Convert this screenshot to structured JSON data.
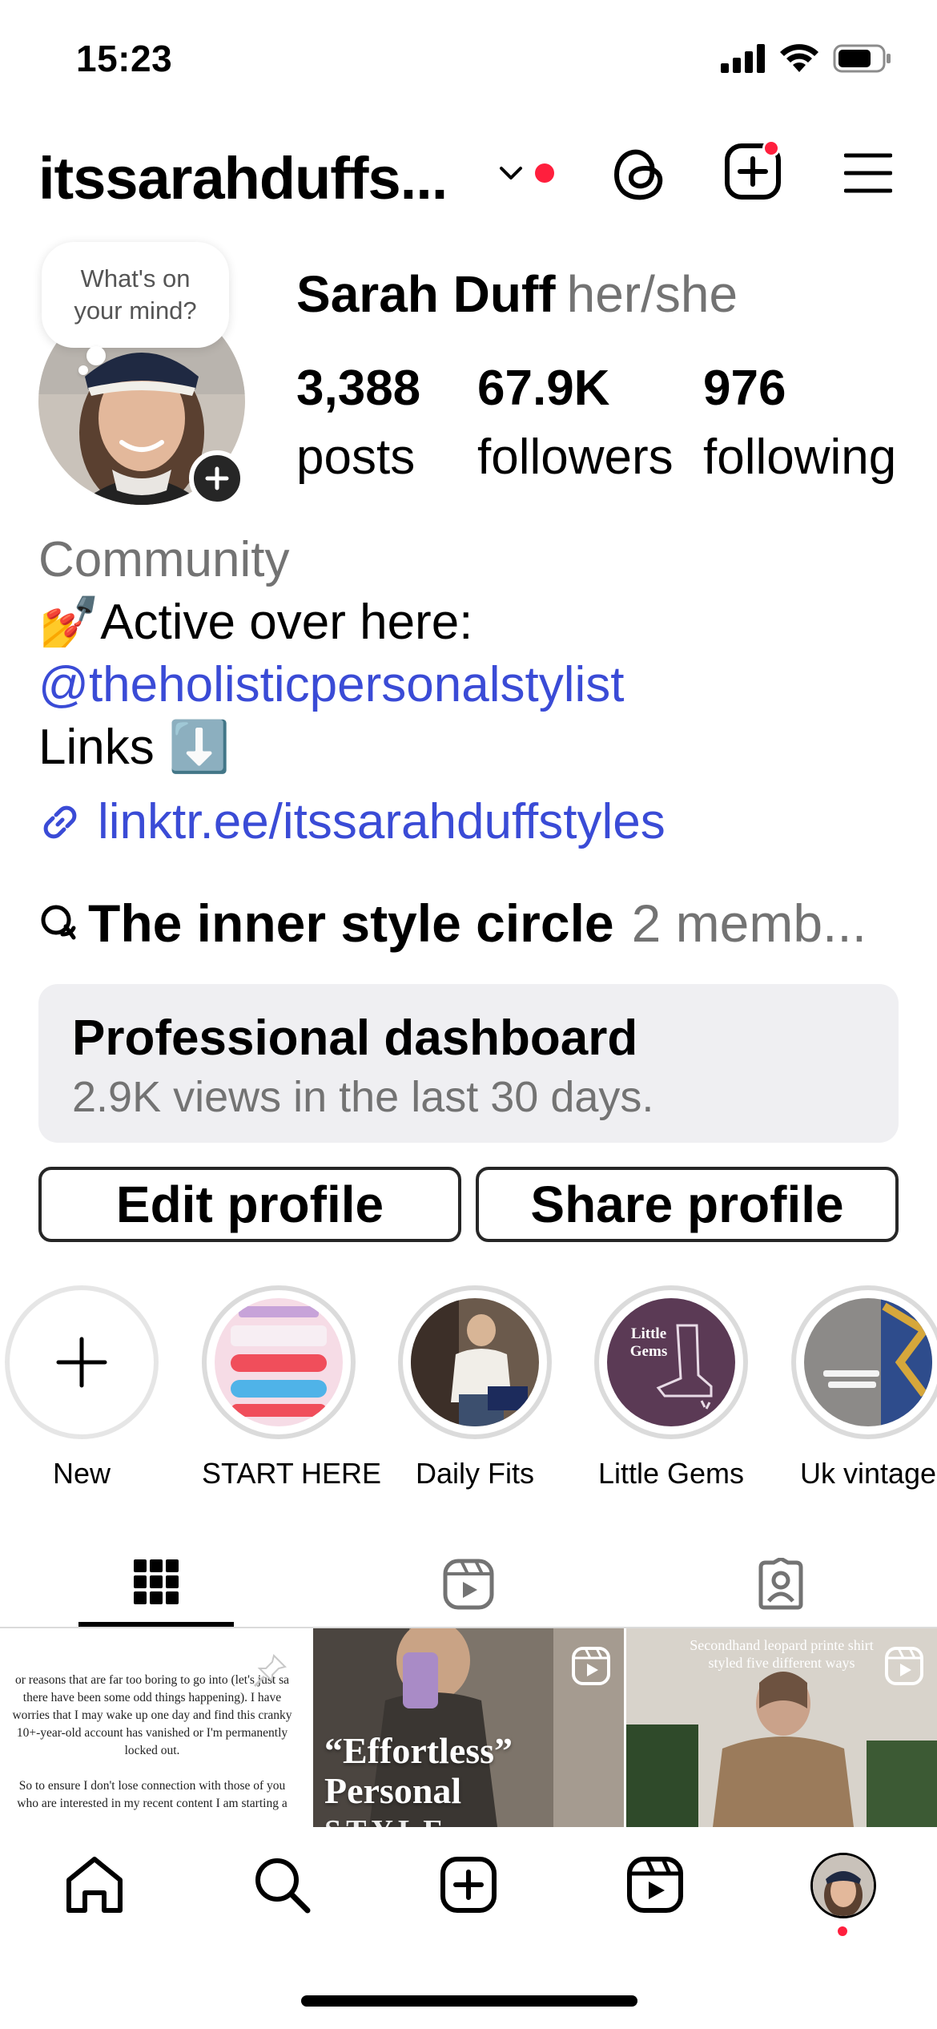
{
  "status_bar": {
    "time": "15:23"
  },
  "header": {
    "username": "itssarahduffs..."
  },
  "profile": {
    "note": {
      "line1": "What's on",
      "line2": "your mind?"
    },
    "name": "Sarah Duff",
    "pronouns": "her/she",
    "stats": [
      {
        "value": "3,388",
        "label": "posts"
      },
      {
        "value": "67.9K",
        "label": "followers"
      },
      {
        "value": "976",
        "label": "following"
      }
    ],
    "bio": {
      "category": "Community",
      "line1": "💅Active over here:",
      "mention": "@theholisticpersonalstylist",
      "line3": "Links ⬇️"
    },
    "link": "linktr.ee/itssarahduffstyles",
    "channel": {
      "name": "The inner style circle",
      "members": "2 memb..."
    }
  },
  "dashboard": {
    "title": "Professional dashboard",
    "subtitle": "2.9K views in the last 30 days."
  },
  "buttons": {
    "edit": "Edit profile",
    "share": "Share profile"
  },
  "highlights": [
    {
      "label": "New"
    },
    {
      "label": "START HERE"
    },
    {
      "label": "Daily Fits"
    },
    {
      "label": "Little Gems",
      "cover_text": "Little Gems"
    },
    {
      "label": "Uk vintage"
    }
  ],
  "posts": [
    {
      "lines": [
        "or reasons that are far too boring to go into (let's just sa",
        "there have been some odd things happening). I have",
        "worries that I may wake up one day and find this cranky",
        "10+-year-old account has vanished or I'm permanently",
        "locked out.",
        "",
        "So to ensure I don't lose connection with those of you",
        "who are interested in my recent content I am starting a"
      ]
    },
    {
      "overlay": "“Effortless” Personal",
      "overlay2": "STYLE"
    },
    {
      "caption1": "Secondhand leopard printe shirt",
      "caption2": "styled five different ways"
    }
  ],
  "colors": {
    "link_blue": "#3a4bd6",
    "notification_red": "#ff1f3d",
    "secondary_text": "#737373"
  }
}
